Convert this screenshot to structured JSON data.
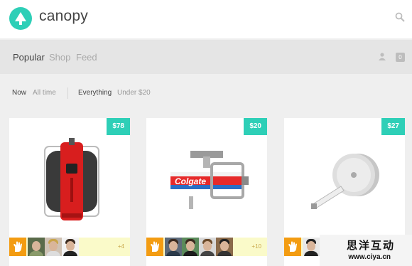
{
  "header": {
    "brand": "canopy",
    "logo_icon": "tree-icon",
    "search_icon": "search-icon",
    "accent": "#2ecfb7"
  },
  "nav": {
    "tabs": [
      {
        "label": "Popular",
        "active": true
      },
      {
        "label": "Shop",
        "active": false
      },
      {
        "label": "Feed",
        "active": false
      }
    ],
    "user_icon": "user-icon",
    "cart_count": "0"
  },
  "filters": {
    "time": [
      {
        "label": "Now",
        "active": true
      },
      {
        "label": "All time",
        "active": false
      }
    ],
    "price": [
      {
        "label": "Everything",
        "active": true
      },
      {
        "label": "Under $20",
        "active": false
      }
    ]
  },
  "products": [
    {
      "price": "$78",
      "image": "red-backpack-suitcase",
      "extra_likes": "+4"
    },
    {
      "price": "$20",
      "image": "toothpaste-squeezer",
      "extra_likes": "+10"
    },
    {
      "price": "$27",
      "image": "tape-measure",
      "extra_likes": ""
    }
  ],
  "watermark": {
    "cn": "思洋互动",
    "url": "www.ciya.cn"
  }
}
